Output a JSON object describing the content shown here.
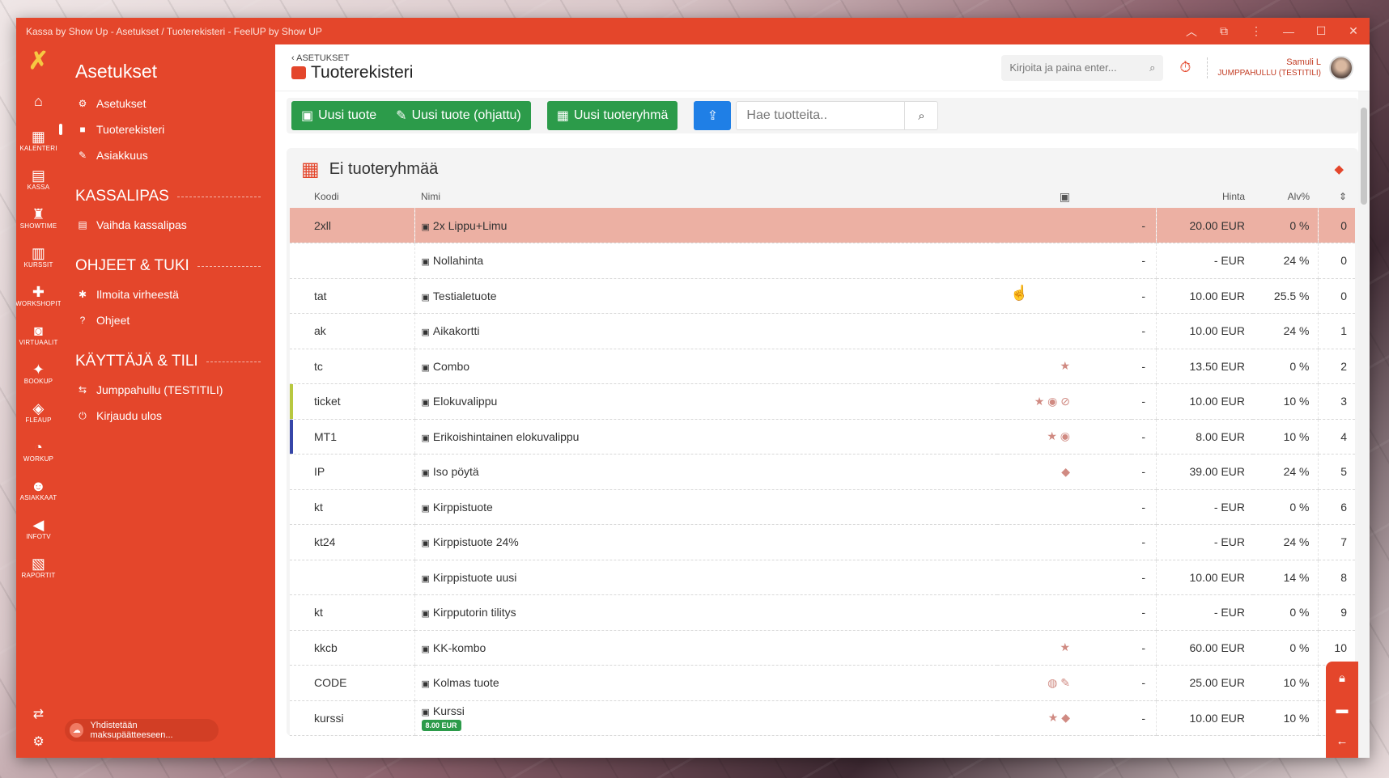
{
  "window": {
    "title": "Kassa by Show Up - Asetukset / Tuoterekisteri - FeelUP by Show UP"
  },
  "rail": {
    "items": [
      {
        "label": "",
        "icon": "home-icon",
        "glyph": "⌂"
      },
      {
        "label": "KALENTERI",
        "icon": "calendar-icon",
        "glyph": "▦"
      },
      {
        "label": "KASSA",
        "icon": "cash-register-icon",
        "glyph": "▤"
      },
      {
        "label": "SHOWTIME",
        "icon": "popcorn-icon",
        "glyph": "♜"
      },
      {
        "label": "KURSSIT",
        "icon": "book-icon",
        "glyph": "▥"
      },
      {
        "label": "WORKSHOPIT",
        "icon": "workshop-icon",
        "glyph": "✚"
      },
      {
        "label": "VIRTUAALIT",
        "icon": "virtual-icon",
        "glyph": "◙"
      },
      {
        "label": "BOOKUP",
        "icon": "booking-icon",
        "glyph": "✦"
      },
      {
        "label": "FLEAUP",
        "icon": "flea-icon",
        "glyph": "◈"
      },
      {
        "label": "WORKUP",
        "icon": "workup-icon",
        "glyph": "◔"
      },
      {
        "label": "ASIAKKAAT",
        "icon": "users-icon",
        "glyph": "☻"
      },
      {
        "label": "INFOTV",
        "icon": "megaphone-icon",
        "glyph": "◀"
      },
      {
        "label": "RAPORTIT",
        "icon": "report-icon",
        "glyph": "▧"
      }
    ]
  },
  "sidebar": {
    "title": "Asetukset",
    "items": [
      {
        "label": "Asetukset",
        "glyph": "⚙"
      },
      {
        "label": "Tuoterekisteri",
        "glyph": "■"
      },
      {
        "label": "Asiakkuus",
        "glyph": "✎"
      }
    ],
    "sections": [
      {
        "title": "KASSALIPAS",
        "items": [
          {
            "label": "Vaihda kassalipas",
            "glyph": "▤"
          }
        ]
      },
      {
        "title": "OHJEET & TUKI",
        "items": [
          {
            "label": "Ilmoita virheestä",
            "glyph": "✱"
          },
          {
            "label": "Ohjeet",
            "glyph": "?"
          }
        ]
      },
      {
        "title": "KÄYTTÄJÄ & TILI",
        "items": [
          {
            "label": "Jumppahullu (TESTITILI)",
            "glyph": "⇆"
          },
          {
            "label": "Kirjaudu ulos",
            "glyph": "⏻"
          }
        ]
      }
    ],
    "terminal_status": "Yhdistetään maksupäätteeseen..."
  },
  "topbar": {
    "back": "ASETUKSET",
    "page_title": "Tuoterekisteri",
    "search_placeholder": "Kirjoita ja paina enter...",
    "user_name": "Samuli L",
    "user_org": "JUMPPAHULLU (TESTITILI)"
  },
  "toolbar": {
    "new_product": "Uusi tuote",
    "new_product_guided": "Uusi tuote (ohjattu)",
    "new_group": "Uusi tuoteryhmä",
    "search_placeholder": "Hae tuotteita.."
  },
  "panel": {
    "title": "Ei tuoteryhmää",
    "columns": {
      "code": "Koodi",
      "name": "Nimi",
      "price": "Hinta",
      "vat": "Alv%"
    },
    "rows": [
      {
        "code": "2xll",
        "name": "2x Lippu+Limu",
        "icons": "",
        "dash": "-",
        "price": "20.00 EUR",
        "vat": "0 %",
        "ord": "0"
      },
      {
        "code": "",
        "name": "Nollahinta",
        "icons": "",
        "dash": "-",
        "price": "- EUR",
        "vat": "24 %",
        "ord": "0"
      },
      {
        "code": "tat",
        "name": "Testialetuote",
        "icons": "",
        "dash": "-",
        "price": "10.00 EUR",
        "vat": "25.5 %",
        "ord": "0"
      },
      {
        "code": "ak",
        "name": "Aikakortti",
        "icons": "",
        "dash": "-",
        "price": "10.00 EUR",
        "vat": "24 %",
        "ord": "1"
      },
      {
        "code": "tc",
        "name": "Combo",
        "icons": "★",
        "dash": "-",
        "price": "13.50 EUR",
        "vat": "0 %",
        "ord": "2"
      },
      {
        "code": "ticket",
        "name": "Elokuvalippu",
        "icons": "★ ◉ ⊘",
        "dash": "-",
        "price": "10.00 EUR",
        "vat": "10 %",
        "ord": "3"
      },
      {
        "code": "MT1",
        "name": "Erikoishintainen elokuvalippu",
        "icons": "★ ◉",
        "dash": "-",
        "price": "8.00 EUR",
        "vat": "10 %",
        "ord": "4"
      },
      {
        "code": "IP",
        "name": "Iso pöytä",
        "icons": "◆",
        "dash": "-",
        "price": "39.00 EUR",
        "vat": "24 %",
        "ord": "5"
      },
      {
        "code": "kt",
        "name": "Kirppistuote",
        "icons": "",
        "dash": "-",
        "price": "- EUR",
        "vat": "0 %",
        "ord": "6"
      },
      {
        "code": "kt24",
        "name": "Kirppistuote 24%",
        "icons": "",
        "dash": "-",
        "price": "- EUR",
        "vat": "24 %",
        "ord": "7"
      },
      {
        "code": "",
        "name": "Kirppistuote uusi",
        "icons": "",
        "dash": "-",
        "price": "10.00 EUR",
        "vat": "14 %",
        "ord": "8"
      },
      {
        "code": "kt",
        "name": "Kirpputorin tilitys",
        "icons": "",
        "dash": "-",
        "price": "- EUR",
        "vat": "0 %",
        "ord": "9"
      },
      {
        "code": "kkcb",
        "name": "KK-kombo",
        "icons": "★",
        "dash": "-",
        "price": "60.00 EUR",
        "vat": "0 %",
        "ord": "10"
      },
      {
        "code": "CODE",
        "name": "Kolmas tuote",
        "icons": "◍ ✎",
        "dash": "-",
        "price": "25.00 EUR",
        "vat": "10 %",
        "ord": ""
      },
      {
        "code": "kurssi",
        "name": "Kurssi",
        "badge": "8.00 EUR",
        "icons": "★ ◆",
        "dash": "-",
        "price": "10.00 EUR",
        "vat": "10 %",
        "ord": ""
      }
    ]
  },
  "colors": {
    "brand": "#e4462b",
    "green": "#2c9b4a",
    "blue": "#1f7fe6",
    "highlight": "#ecb0a3"
  }
}
